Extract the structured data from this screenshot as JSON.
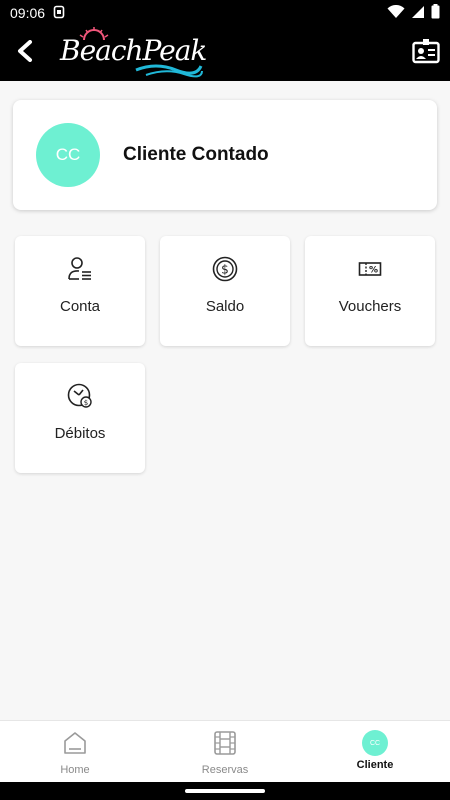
{
  "status_bar": {
    "time": "09:06"
  },
  "app": {
    "logo_text": "BeachPeak"
  },
  "profile": {
    "initials": "CC",
    "name": "Cliente Contado",
    "avatar_color": "#6ef0d2"
  },
  "tiles": [
    {
      "label": "Conta",
      "icon": "person-list-icon"
    },
    {
      "label": "Saldo",
      "icon": "dollar-coin-icon"
    },
    {
      "label": "Vouchers",
      "icon": "percent-ticket-icon"
    },
    {
      "label": "Débitos",
      "icon": "clock-debit-icon"
    }
  ],
  "bottom_nav": {
    "items": [
      {
        "label": "Home",
        "icon": "home-icon"
      },
      {
        "label": "Reservas",
        "icon": "film-reservations-icon"
      },
      {
        "label": "Cliente",
        "icon": "client-avatar-icon",
        "initials": "CC",
        "active": true
      }
    ]
  }
}
